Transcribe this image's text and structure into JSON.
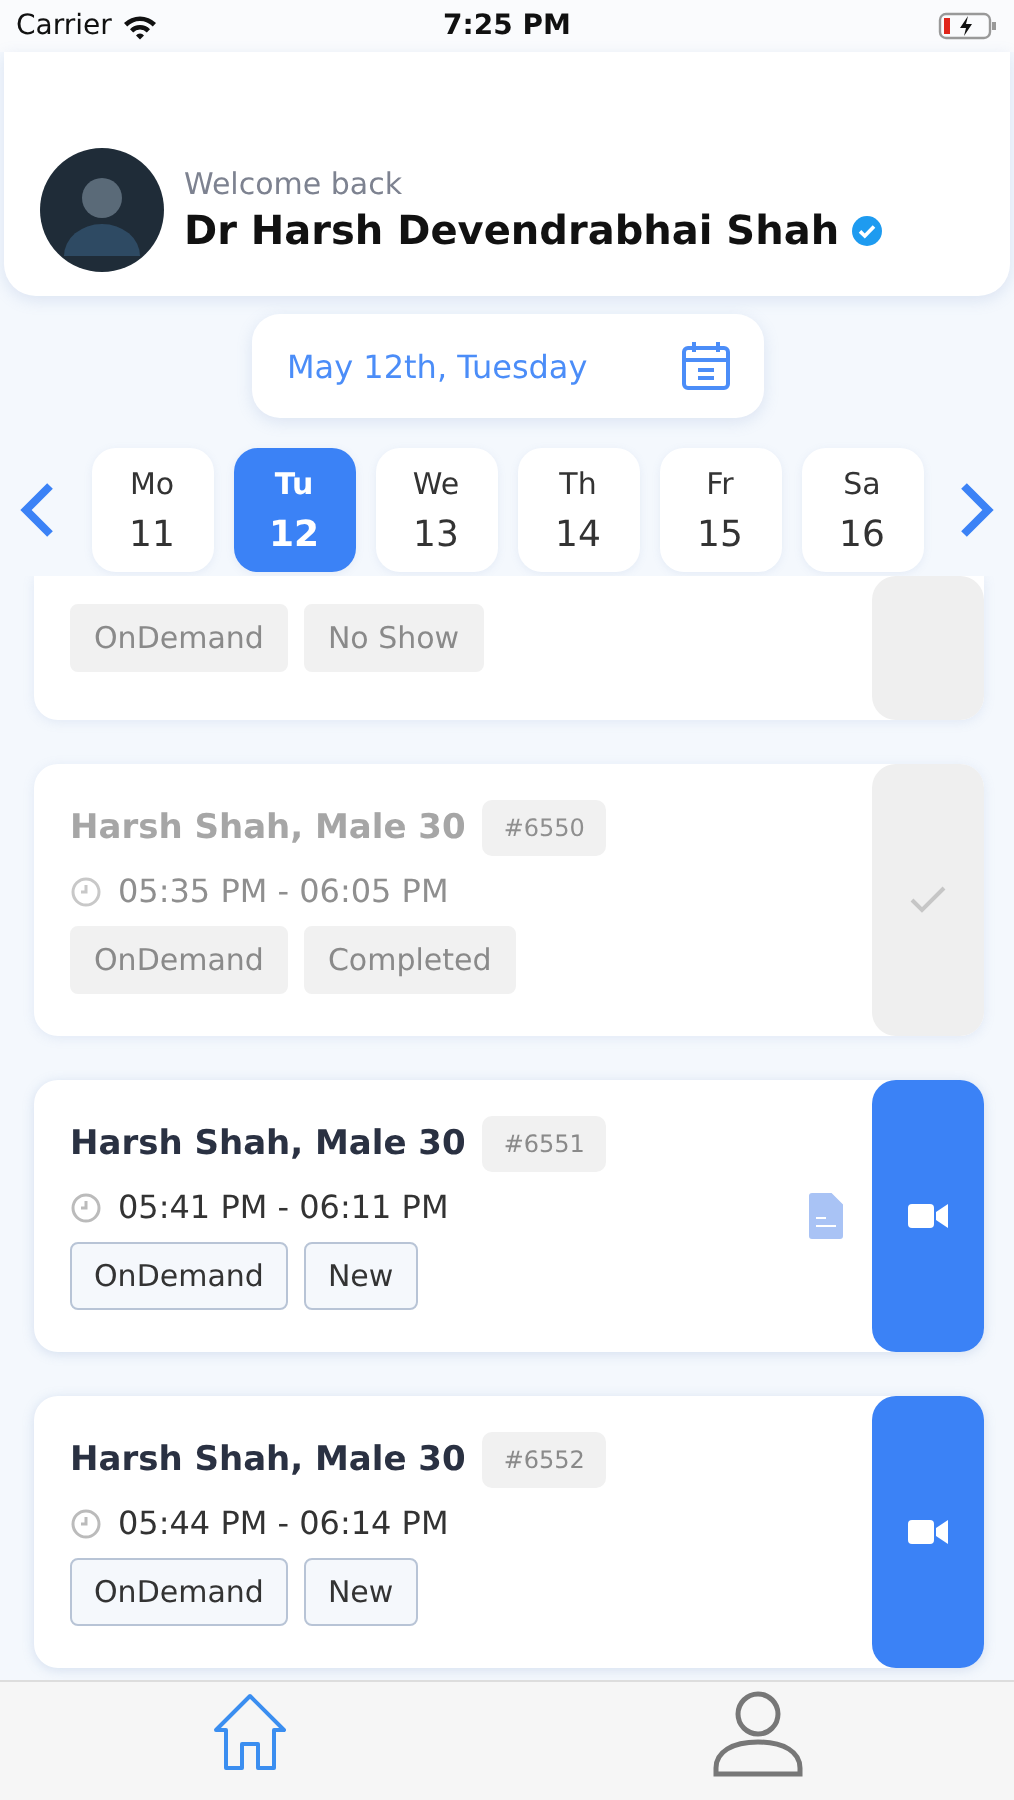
{
  "status_bar": {
    "carrier": "Carrier",
    "time": "7:25 PM"
  },
  "header": {
    "greeting": "Welcome back",
    "name": "Dr Harsh Devendrabhai Shah",
    "verified": true
  },
  "date_picker": {
    "label": "May 12th, Tuesday"
  },
  "days": [
    {
      "weekday": "Mo",
      "day": "11",
      "selected": false
    },
    {
      "weekday": "Tu",
      "day": "12",
      "selected": true
    },
    {
      "weekday": "We",
      "day": "13",
      "selected": false
    },
    {
      "weekday": "Th",
      "day": "14",
      "selected": false
    },
    {
      "weekday": "Fr",
      "day": "15",
      "selected": false
    },
    {
      "weekday": "Sa",
      "day": "16",
      "selected": false
    }
  ],
  "appointments": [
    {
      "partial": true,
      "tags": [
        "OnDemand",
        "No Show"
      ],
      "kind": "no_show",
      "document": false
    },
    {
      "partial": false,
      "patient": "Harsh Shah, Male 30",
      "id": "#6550",
      "time": "05:35 PM - 06:05 PM",
      "tags": [
        "OnDemand",
        "Completed"
      ],
      "kind": "completed",
      "document": false
    },
    {
      "partial": false,
      "patient": "Harsh Shah, Male 30",
      "id": "#6551",
      "time": "05:41 PM - 06:11 PM",
      "tags": [
        "OnDemand",
        "New"
      ],
      "kind": "new",
      "document": true
    },
    {
      "partial": false,
      "patient": "Harsh Shah, Male 30",
      "id": "#6552",
      "time": "05:44 PM - 06:14 PM",
      "tags": [
        "OnDemand",
        "New"
      ],
      "kind": "new",
      "document": false
    }
  ],
  "tab_bar": [
    {
      "kind": "home",
      "selected": true
    },
    {
      "kind": "profile",
      "selected": false
    }
  ]
}
